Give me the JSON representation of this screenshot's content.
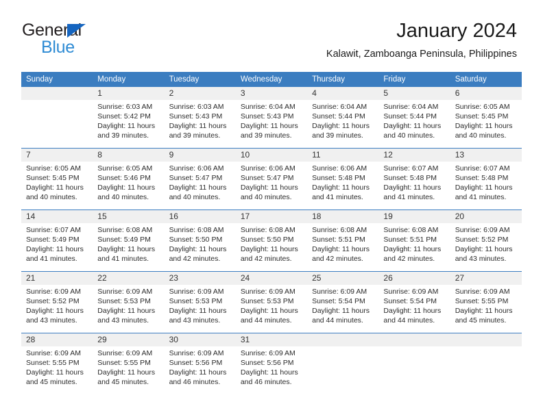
{
  "brand": {
    "name_part1": "General",
    "name_part2": "Blue",
    "triangle_color": "#1565c0",
    "blue_color": "#2e8bd4"
  },
  "header": {
    "title": "January 2024",
    "subtitle": "Kalawit, Zamboanga Peninsula, Philippines"
  },
  "theme": {
    "header_bar_color": "#3b7dc0",
    "daynum_bg": "#f0f0f0",
    "grid_line_color": "#3b7dc0"
  },
  "weekdays": [
    "Sunday",
    "Monday",
    "Tuesday",
    "Wednesday",
    "Thursday",
    "Friday",
    "Saturday"
  ],
  "weeks": [
    [
      {
        "day": "",
        "sunrise": "",
        "sunset": "",
        "daylight": ""
      },
      {
        "day": "1",
        "sunrise": "Sunrise: 6:03 AM",
        "sunset": "Sunset: 5:42 PM",
        "daylight": "Daylight: 11 hours and 39 minutes."
      },
      {
        "day": "2",
        "sunrise": "Sunrise: 6:03 AM",
        "sunset": "Sunset: 5:43 PM",
        "daylight": "Daylight: 11 hours and 39 minutes."
      },
      {
        "day": "3",
        "sunrise": "Sunrise: 6:04 AM",
        "sunset": "Sunset: 5:43 PM",
        "daylight": "Daylight: 11 hours and 39 minutes."
      },
      {
        "day": "4",
        "sunrise": "Sunrise: 6:04 AM",
        "sunset": "Sunset: 5:44 PM",
        "daylight": "Daylight: 11 hours and 39 minutes."
      },
      {
        "day": "5",
        "sunrise": "Sunrise: 6:04 AM",
        "sunset": "Sunset: 5:44 PM",
        "daylight": "Daylight: 11 hours and 40 minutes."
      },
      {
        "day": "6",
        "sunrise": "Sunrise: 6:05 AM",
        "sunset": "Sunset: 5:45 PM",
        "daylight": "Daylight: 11 hours and 40 minutes."
      }
    ],
    [
      {
        "day": "7",
        "sunrise": "Sunrise: 6:05 AM",
        "sunset": "Sunset: 5:45 PM",
        "daylight": "Daylight: 11 hours and 40 minutes."
      },
      {
        "day": "8",
        "sunrise": "Sunrise: 6:05 AM",
        "sunset": "Sunset: 5:46 PM",
        "daylight": "Daylight: 11 hours and 40 minutes."
      },
      {
        "day": "9",
        "sunrise": "Sunrise: 6:06 AM",
        "sunset": "Sunset: 5:47 PM",
        "daylight": "Daylight: 11 hours and 40 minutes."
      },
      {
        "day": "10",
        "sunrise": "Sunrise: 6:06 AM",
        "sunset": "Sunset: 5:47 PM",
        "daylight": "Daylight: 11 hours and 40 minutes."
      },
      {
        "day": "11",
        "sunrise": "Sunrise: 6:06 AM",
        "sunset": "Sunset: 5:48 PM",
        "daylight": "Daylight: 11 hours and 41 minutes."
      },
      {
        "day": "12",
        "sunrise": "Sunrise: 6:07 AM",
        "sunset": "Sunset: 5:48 PM",
        "daylight": "Daylight: 11 hours and 41 minutes."
      },
      {
        "day": "13",
        "sunrise": "Sunrise: 6:07 AM",
        "sunset": "Sunset: 5:48 PM",
        "daylight": "Daylight: 11 hours and 41 minutes."
      }
    ],
    [
      {
        "day": "14",
        "sunrise": "Sunrise: 6:07 AM",
        "sunset": "Sunset: 5:49 PM",
        "daylight": "Daylight: 11 hours and 41 minutes."
      },
      {
        "day": "15",
        "sunrise": "Sunrise: 6:08 AM",
        "sunset": "Sunset: 5:49 PM",
        "daylight": "Daylight: 11 hours and 41 minutes."
      },
      {
        "day": "16",
        "sunrise": "Sunrise: 6:08 AM",
        "sunset": "Sunset: 5:50 PM",
        "daylight": "Daylight: 11 hours and 42 minutes."
      },
      {
        "day": "17",
        "sunrise": "Sunrise: 6:08 AM",
        "sunset": "Sunset: 5:50 PM",
        "daylight": "Daylight: 11 hours and 42 minutes."
      },
      {
        "day": "18",
        "sunrise": "Sunrise: 6:08 AM",
        "sunset": "Sunset: 5:51 PM",
        "daylight": "Daylight: 11 hours and 42 minutes."
      },
      {
        "day": "19",
        "sunrise": "Sunrise: 6:08 AM",
        "sunset": "Sunset: 5:51 PM",
        "daylight": "Daylight: 11 hours and 42 minutes."
      },
      {
        "day": "20",
        "sunrise": "Sunrise: 6:09 AM",
        "sunset": "Sunset: 5:52 PM",
        "daylight": "Daylight: 11 hours and 43 minutes."
      }
    ],
    [
      {
        "day": "21",
        "sunrise": "Sunrise: 6:09 AM",
        "sunset": "Sunset: 5:52 PM",
        "daylight": "Daylight: 11 hours and 43 minutes."
      },
      {
        "day": "22",
        "sunrise": "Sunrise: 6:09 AM",
        "sunset": "Sunset: 5:53 PM",
        "daylight": "Daylight: 11 hours and 43 minutes."
      },
      {
        "day": "23",
        "sunrise": "Sunrise: 6:09 AM",
        "sunset": "Sunset: 5:53 PM",
        "daylight": "Daylight: 11 hours and 43 minutes."
      },
      {
        "day": "24",
        "sunrise": "Sunrise: 6:09 AM",
        "sunset": "Sunset: 5:53 PM",
        "daylight": "Daylight: 11 hours and 44 minutes."
      },
      {
        "day": "25",
        "sunrise": "Sunrise: 6:09 AM",
        "sunset": "Sunset: 5:54 PM",
        "daylight": "Daylight: 11 hours and 44 minutes."
      },
      {
        "day": "26",
        "sunrise": "Sunrise: 6:09 AM",
        "sunset": "Sunset: 5:54 PM",
        "daylight": "Daylight: 11 hours and 44 minutes."
      },
      {
        "day": "27",
        "sunrise": "Sunrise: 6:09 AM",
        "sunset": "Sunset: 5:55 PM",
        "daylight": "Daylight: 11 hours and 45 minutes."
      }
    ],
    [
      {
        "day": "28",
        "sunrise": "Sunrise: 6:09 AM",
        "sunset": "Sunset: 5:55 PM",
        "daylight": "Daylight: 11 hours and 45 minutes."
      },
      {
        "day": "29",
        "sunrise": "Sunrise: 6:09 AM",
        "sunset": "Sunset: 5:55 PM",
        "daylight": "Daylight: 11 hours and 45 minutes."
      },
      {
        "day": "30",
        "sunrise": "Sunrise: 6:09 AM",
        "sunset": "Sunset: 5:56 PM",
        "daylight": "Daylight: 11 hours and 46 minutes."
      },
      {
        "day": "31",
        "sunrise": "Sunrise: 6:09 AM",
        "sunset": "Sunset: 5:56 PM",
        "daylight": "Daylight: 11 hours and 46 minutes."
      },
      {
        "day": "",
        "sunrise": "",
        "sunset": "",
        "daylight": ""
      },
      {
        "day": "",
        "sunrise": "",
        "sunset": "",
        "daylight": ""
      },
      {
        "day": "",
        "sunrise": "",
        "sunset": "",
        "daylight": ""
      }
    ]
  ]
}
